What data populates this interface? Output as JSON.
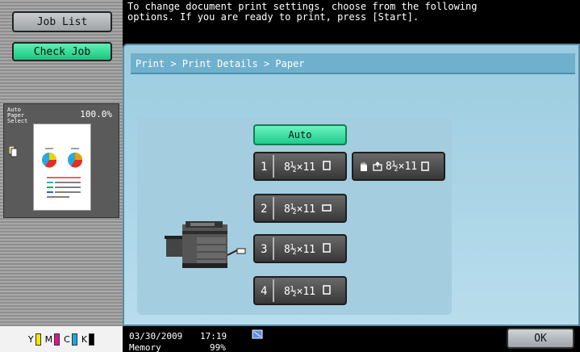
{
  "left_panel": {
    "job_list_label": "Job List",
    "check_job_label": "Check Job",
    "preview": {
      "title": "Auto Paper Select",
      "scale": "100.0%"
    },
    "toner": [
      {
        "label": "Y",
        "color": "#f3e600"
      },
      {
        "label": "M",
        "color": "#e0148c"
      },
      {
        "label": "C",
        "color": "#19a7e0"
      },
      {
        "label": "K",
        "color": "#000000"
      }
    ]
  },
  "header": {
    "message": "To change document print settings, choose from the following\noptions. If you are ready to print, press [Start]."
  },
  "main": {
    "breadcrumb": "Print > Print Details > Paper",
    "auto_label": "Auto",
    "trays": [
      {
        "num": "1",
        "size": "8½×11",
        "orientation_icon": "portrait-icon"
      },
      {
        "num": "2",
        "size": "8½×11",
        "orientation_icon": "landscape-icon"
      },
      {
        "num": "3",
        "size": "8½×11",
        "orientation_icon": "portrait-icon"
      },
      {
        "num": "4",
        "size": "8½×11",
        "orientation_icon": "portrait-icon"
      }
    ],
    "bypass": {
      "size": "8½×11",
      "icons": [
        "hand-icon",
        "bypass-tray-icon",
        "portrait-icon"
      ]
    }
  },
  "status": {
    "date": "03/30/2009",
    "time": "17:19",
    "memory_label": "Memory",
    "memory_value": "99%"
  },
  "ok_label": "OK",
  "colors": {
    "accent_green": "#1dcc8c",
    "panel_blue": "#9ccce0",
    "breadcrumb_blue": "#6fb1cd"
  }
}
